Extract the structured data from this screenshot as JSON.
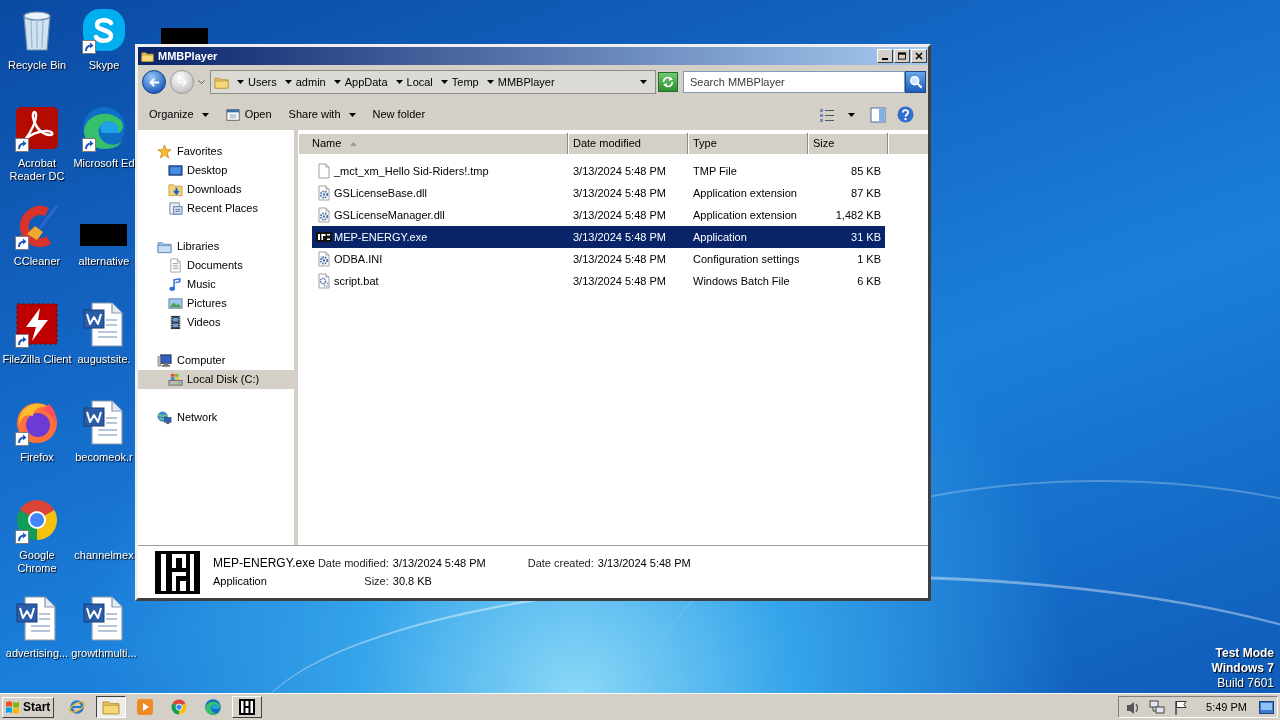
{
  "desktop": {
    "icons": [
      {
        "kind": "bin",
        "label": "Recycle Bin",
        "shortcut": false
      },
      {
        "kind": "pdf",
        "label": "Acrobat Reader DC",
        "shortcut": true
      },
      {
        "kind": "cleaner",
        "label": "CCleaner",
        "shortcut": true
      },
      {
        "kind": "ftp",
        "label": "FileZilla Client",
        "shortcut": true
      },
      {
        "kind": "firefox",
        "label": "Firefox",
        "shortcut": true
      },
      {
        "kind": "chrome",
        "label": "Google Chrome",
        "shortcut": true
      },
      {
        "kind": "doc",
        "label": "advertising...",
        "shortcut": false
      },
      {
        "kind": "skype",
        "label": "Skype",
        "shortcut": true
      },
      {
        "kind": "edge",
        "label": "Microsoft Ed",
        "shortcut": true
      },
      {
        "kind": "redacted",
        "label": "alternative",
        "shortcut": false
      },
      {
        "kind": "doc",
        "label": "augustsite.",
        "shortcut": false
      },
      {
        "kind": "doc",
        "label": "becomeok.r",
        "shortcut": false
      },
      {
        "kind": "none",
        "label": "channelmex",
        "shortcut": false
      },
      {
        "kind": "doc",
        "label": "growthmulti...",
        "shortcut": false
      },
      {
        "kind": "redacted",
        "shortcut": false
      }
    ],
    "notice": [
      {
        "text": "Test Mode",
        "bold": true
      },
      {
        "text": "Windows 7",
        "bold": true
      },
      {
        "text": "Build 7601",
        "bold": false
      }
    ]
  },
  "window": {
    "title": "MMBPlayer",
    "nav_buttons": [
      {
        "kind": "back",
        "disabled": false
      },
      {
        "kind": "forward",
        "disabled": true
      }
    ],
    "breadcrumbs": [
      "Users",
      "admin",
      "AppData",
      "Local",
      "Temp",
      "MMBPlayer"
    ],
    "search": {
      "placeholder": "Search MMBPlayer"
    },
    "toolbar": [
      {
        "kind": "menu",
        "label": "Organize"
      },
      {
        "kind": "open",
        "label": "Open"
      },
      {
        "kind": "menu",
        "label": "Share with"
      },
      {
        "kind": "plain",
        "label": "New folder"
      }
    ],
    "nav": [
      {
        "kind": "star",
        "label": "Favorites",
        "selected": false,
        "children": [
          {
            "kind": "desktop",
            "label": "Desktop",
            "selected": false
          },
          {
            "kind": "downloads",
            "label": "Downloads",
            "selected": false
          },
          {
            "kind": "recent",
            "label": "Recent Places",
            "selected": false
          }
        ]
      },
      {
        "kind": "libraries",
        "label": "Libraries",
        "selected": false,
        "children": [
          {
            "kind": "documents",
            "label": "Documents",
            "selected": false
          },
          {
            "kind": "music",
            "label": "Music",
            "selected": false
          },
          {
            "kind": "pictures",
            "label": "Pictures",
            "selected": false
          },
          {
            "kind": "videos",
            "label": "Videos",
            "selected": false
          }
        ]
      },
      {
        "kind": "computer",
        "label": "Computer",
        "selected": false,
        "children": [
          {
            "kind": "disk",
            "label": "Local Disk (C:)",
            "selected": true
          }
        ]
      },
      {
        "kind": "network",
        "label": "Network",
        "selected": false
      }
    ],
    "table": {
      "columns": [
        {
          "label": "Name",
          "sorted": true
        },
        {
          "label": "Date modified",
          "sorted": false
        },
        {
          "label": "Type",
          "sorted": false
        },
        {
          "label": "Size",
          "sorted": false
        }
      ],
      "rows": [
        {
          "kind": "tmp",
          "name": "_mct_xm_Hello Sid-Riders!.tmp",
          "modified": "3/13/2024 5:48 PM",
          "type": "TMP File",
          "size": "85 KB",
          "selected": false
        },
        {
          "kind": "dll",
          "name": "GSLicenseBase.dll",
          "modified": "3/13/2024 5:48 PM",
          "type": "Application extension",
          "size": "87 KB",
          "selected": false
        },
        {
          "kind": "dll",
          "name": "GSLicenseManager.dll",
          "modified": "3/13/2024 5:48 PM",
          "type": "Application extension",
          "size": "1,482 KB",
          "selected": false
        },
        {
          "kind": "exe",
          "name": "MEP-ENERGY.exe",
          "modified": "3/13/2024 5:48 PM",
          "type": "Application",
          "size": "31 KB",
          "selected": true
        },
        {
          "kind": "ini",
          "name": "ODBA.INI",
          "modified": "3/13/2024 5:48 PM",
          "type": "Configuration settings",
          "size": "1 KB",
          "selected": false
        },
        {
          "kind": "bat",
          "name": "script.bat",
          "modified": "3/13/2024 5:48 PM",
          "type": "Windows Batch File",
          "size": "6 KB",
          "selected": false
        }
      ]
    },
    "details": {
      "name": "MEP-ENERGY.exe",
      "type": "Application",
      "properties": [
        {
          "label": "Date modified:",
          "value": "3/13/2024 5:48 PM"
        },
        {
          "label": "Size:",
          "value": "30.8 KB"
        },
        {
          "label": "Date created:",
          "value": "3/13/2024 5:48 PM"
        }
      ]
    }
  },
  "taskbar": {
    "start": "Start",
    "apps": [
      {
        "kind": "ie",
        "selected": false,
        "running": false
      },
      {
        "kind": "explorer",
        "selected": true,
        "running": true
      },
      {
        "kind": "player",
        "selected": false,
        "running": false
      },
      {
        "kind": "chrome",
        "selected": false,
        "running": false
      },
      {
        "kind": "edge",
        "selected": false,
        "running": false
      },
      {
        "kind": "app",
        "selected": false,
        "running": true
      }
    ],
    "tray": [
      {
        "kind": "volume"
      },
      {
        "kind": "network"
      },
      {
        "kind": "flag"
      }
    ],
    "clock": "5:49 PM"
  }
}
